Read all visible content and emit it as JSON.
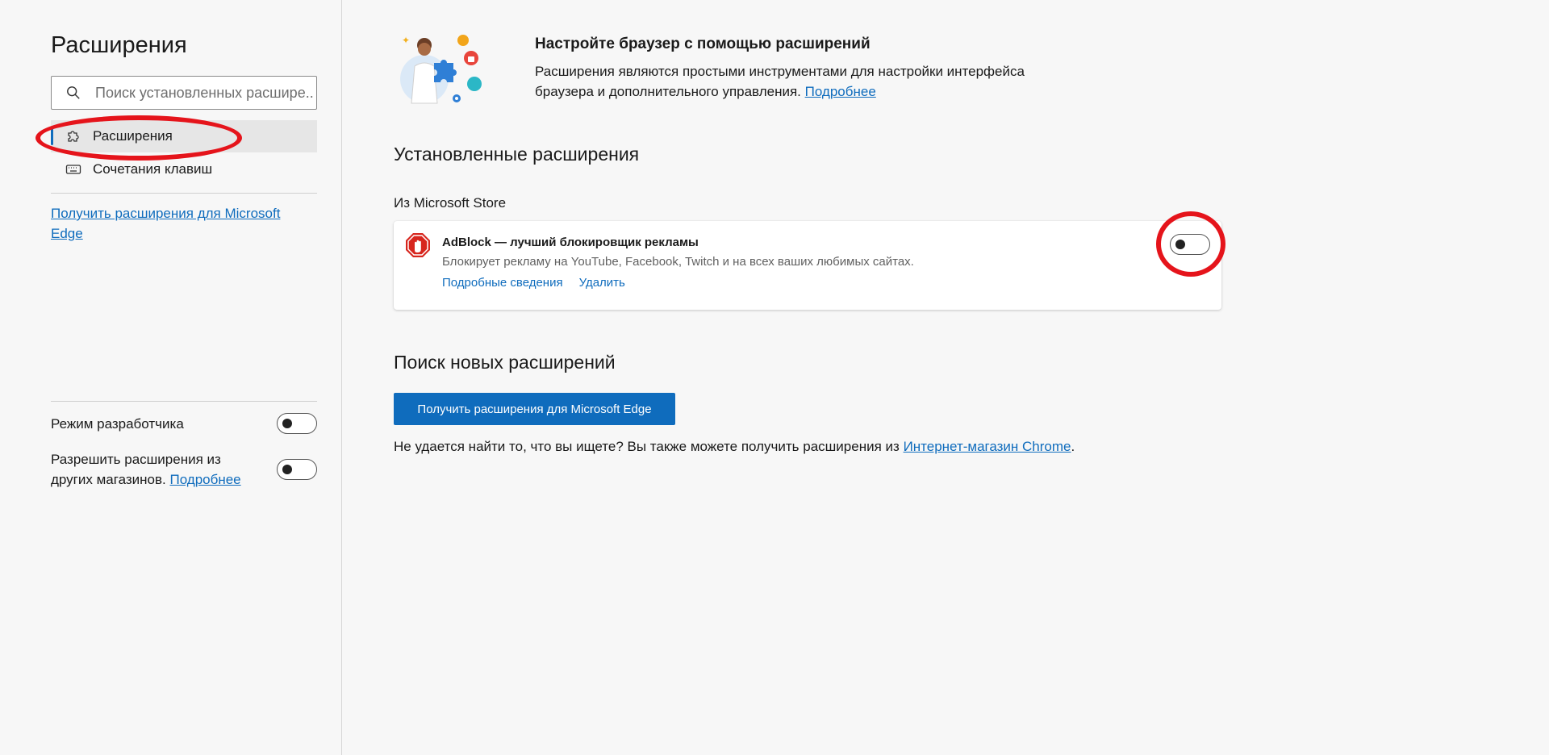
{
  "sidebar": {
    "title": "Расширения",
    "search_placeholder": "Поиск установленных расшире...",
    "nav": [
      {
        "label": "Расширения",
        "icon": "puzzle-icon",
        "active": true
      },
      {
        "label": "Сочетания клавиш",
        "icon": "keyboard-icon",
        "active": false
      }
    ],
    "get_extensions_link": "Получить расширения для Microsoft Edge",
    "developer_mode_label": "Режим разработчика",
    "allow_other_stores_label": "Разрешить расширения из других магазинов.",
    "allow_other_stores_link": "Подробнее"
  },
  "hero": {
    "title": "Настройте браузер с помощью расширений",
    "description": "Расширения являются простыми инструментами для настройки интерфейса браузера и дополнительного управления.",
    "learn_more": "Подробнее"
  },
  "installed": {
    "title": "Установленные расширения",
    "source_label": "Из Microsoft Store",
    "extensions": [
      {
        "name": "AdBlock — лучший блокировщик рекламы",
        "description": "Блокирует рекламу на YouTube, Facebook, Twitch и на всех ваших любимых сайтах.",
        "details_link": "Подробные сведения",
        "remove_link": "Удалить",
        "enabled": false
      }
    ]
  },
  "find_new": {
    "title": "Поиск новых расширений",
    "button_label": "Получить расширения для Microsoft Edge",
    "footer_text": "Не удается найти то, что вы ищете? Вы также можете получить расширения из",
    "footer_link": "Интернет-магазин Chrome",
    "footer_end": "."
  },
  "colors": {
    "accent": "#0f6cbd",
    "annotation": "#e5141b"
  }
}
